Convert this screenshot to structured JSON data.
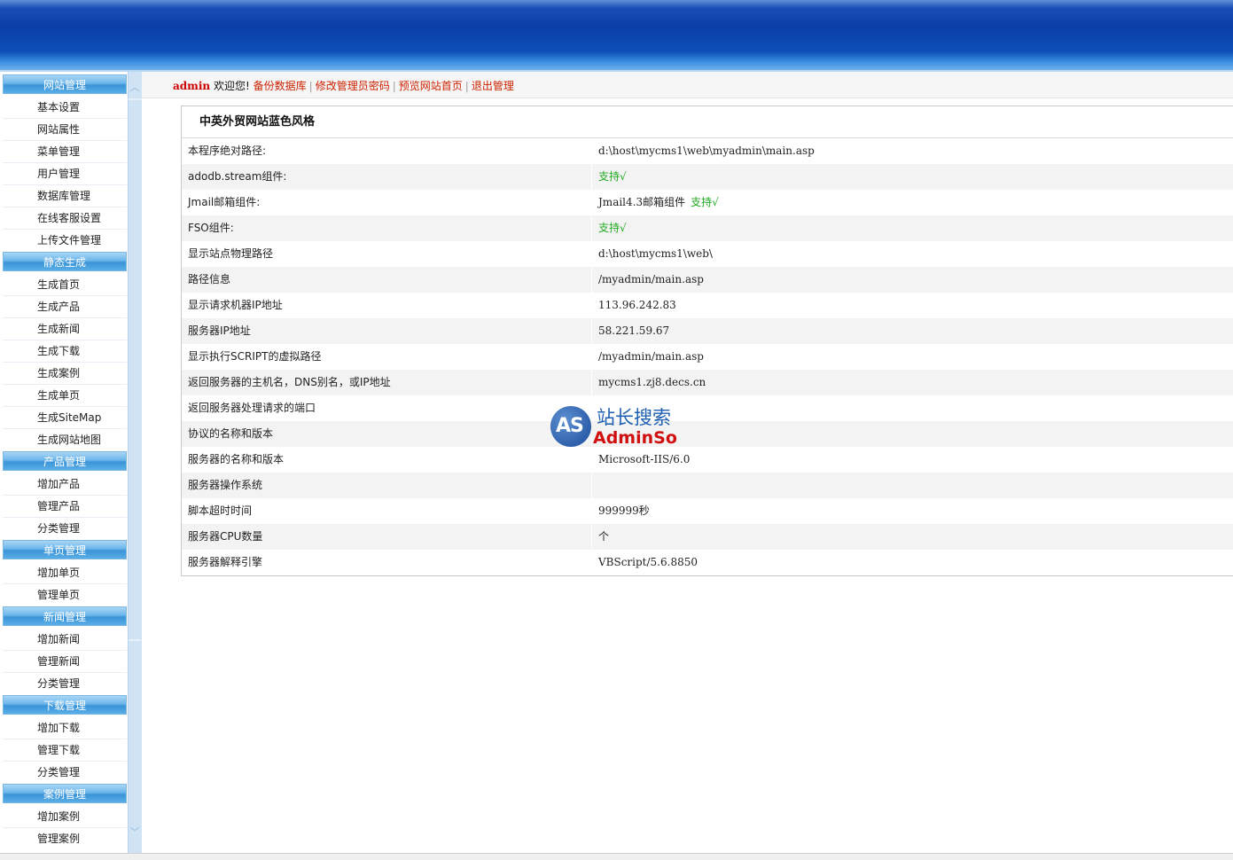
{
  "sidebar": {
    "groups": [
      {
        "title": "网站管理",
        "items": [
          "基本设置",
          "网站属性",
          "菜单管理",
          "用户管理",
          "数据库管理",
          "在线客服设置",
          "上传文件管理"
        ]
      },
      {
        "title": "静态生成",
        "items": [
          "生成首页",
          "生成产品",
          "生成新闻",
          "生成下载",
          "生成案例",
          "生成单页",
          "生成SiteMap",
          "生成网站地图"
        ]
      },
      {
        "title": "产品管理",
        "items": [
          "增加产品",
          "管理产品",
          "分类管理"
        ]
      },
      {
        "title": "单页管理",
        "items": [
          "增加单页",
          "管理单页"
        ]
      },
      {
        "title": "新闻管理",
        "items": [
          "增加新闻",
          "管理新闻",
          "分类管理"
        ]
      },
      {
        "title": "下载管理",
        "items": [
          "增加下载",
          "管理下载",
          "分类管理"
        ]
      },
      {
        "title": "案例管理",
        "items": [
          "增加案例",
          "管理案例"
        ]
      }
    ]
  },
  "topbar": {
    "admin_name": "admin",
    "welcome": "欢迎您!",
    "links": [
      "备份数据库",
      "修改管理员密码",
      "预览网站首页",
      "退出管理"
    ]
  },
  "panel": {
    "title": "中英外贸网站蓝色风格",
    "rows": [
      {
        "label": "本程序绝对路径:",
        "value": "d:\\host\\mycms1\\web\\myadmin\\main.asp"
      },
      {
        "label": "adodb.stream组件:",
        "value": "",
        "status": "支持√"
      },
      {
        "label": "Jmail邮箱组件:",
        "value": "Jmail4.3邮箱组件",
        "status": "支持√"
      },
      {
        "label": "FSO组件:",
        "value": "",
        "status": "支持√"
      },
      {
        "label": "显示站点物理路径",
        "value": "d:\\host\\mycms1\\web\\"
      },
      {
        "label": "路径信息",
        "value": "/myadmin/main.asp"
      },
      {
        "label": "显示请求机器IP地址",
        "value": "113.96.242.83"
      },
      {
        "label": "服务器IP地址",
        "value": "58.221.59.67"
      },
      {
        "label": "显示执行SCRIPT的虚拟路径",
        "value": "/myadmin/main.asp"
      },
      {
        "label": "返回服务器的主机名，DNS别名，或IP地址",
        "value": "mycms1.zj8.decs.cn"
      },
      {
        "label": "返回服务器处理请求的端口",
        "value": ""
      },
      {
        "label": "协议的名称和版本",
        "value": ""
      },
      {
        "label": "服务器的名称和版本",
        "value": "Microsoft-IIS/6.0"
      },
      {
        "label": "服务器操作系统",
        "value": ""
      },
      {
        "label": "脚本超时时间",
        "value": "999999秒"
      },
      {
        "label": "服务器CPU数量",
        "value": "个"
      },
      {
        "label": "服务器解释引擎",
        "value": "VBScript/5.6.8850"
      }
    ]
  },
  "watermark": {
    "logo": "AS",
    "cn": "站长搜索",
    "en": "AdminSo"
  },
  "colors": {
    "header_blue": "#0a3fa6",
    "menu_header": "#3a94d8",
    "link_red": "#cc2200",
    "ok_green": "#22aa22"
  },
  "icons": {
    "scroll_up": "chevron-up-icon",
    "scroll_down": "chevron-down-icon"
  }
}
